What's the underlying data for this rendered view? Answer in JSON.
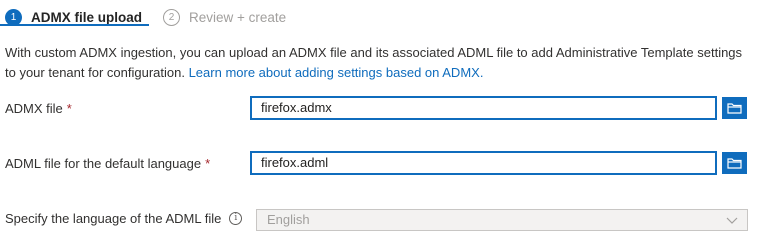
{
  "wizard": {
    "steps": [
      {
        "number": "1",
        "label": "ADMX file upload"
      },
      {
        "number": "2",
        "label": "Review + create"
      }
    ]
  },
  "description": {
    "text": "With custom ADMX ingestion, you can upload an ADMX file and its associated ADML file to add Administrative Template settings to your tenant for configuration.",
    "link_text": "Learn more about adding settings based on ADMX."
  },
  "form": {
    "admx": {
      "label": "ADMX file",
      "required_mark": "*",
      "value": "firefox.admx"
    },
    "adml": {
      "label": "ADML file for the default language",
      "required_mark": "*",
      "value": "firefox.adml"
    },
    "language": {
      "label": "Specify the language of the ADML file",
      "info_glyph": "i",
      "value": "English"
    }
  },
  "icons": {
    "browse": "folder-icon",
    "info": "info-icon",
    "dropdown": "chevron-down-icon"
  },
  "colors": {
    "accent": "#0f6cbd",
    "required": "#a4262c",
    "disabled_bg": "#f3f2f1"
  }
}
